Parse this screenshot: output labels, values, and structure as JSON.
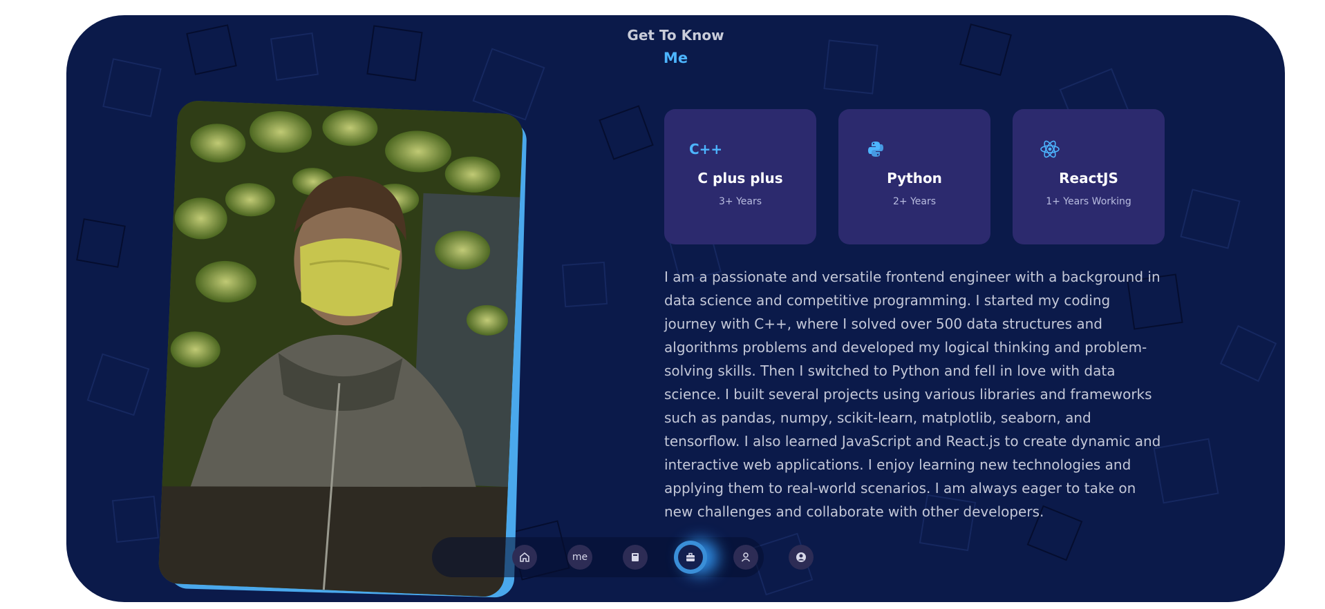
{
  "heading": {
    "subtitle": "Get To Know",
    "title": "Me"
  },
  "skills": [
    {
      "icon": "cplusplus-icon",
      "icon_text": "C++",
      "name": "C plus plus",
      "experience": "3+ Years"
    },
    {
      "icon": "python-icon",
      "name": "Python",
      "experience": "2+ Years"
    },
    {
      "icon": "react-icon",
      "name": "ReactJS",
      "experience": "1+ Years Working"
    }
  ],
  "about_text": "I am a passionate and versatile frontend engineer with a background in data science and competitive programming. I started my coding journey with C++, where I solved over 500 data structures and algorithms problems and developed my logical thinking and problem-solving skills. Then I switched to Python and fell in love with data science. I built several projects using various libraries and frameworks such as pandas, numpy, scikit-learn, matplotlib, seaborn, and tensorflow. I also learned JavaScript and React.js to create dynamic and interactive web applications. I enjoy learning new technologies and applying them to real-world scenarios. I am always eager to take on new challenges and collaborate with other developers.",
  "nav": {
    "items": [
      {
        "icon": "home-icon"
      },
      {
        "label": "me"
      },
      {
        "icon": "book-icon"
      },
      {
        "icon": "briefcase-icon",
        "active": true
      },
      {
        "icon": "user-icon"
      },
      {
        "icon": "user-circle-icon"
      }
    ]
  },
  "colors": {
    "background": "#0b1a4a",
    "accent": "#4db5ff",
    "card": "#2c2a6e",
    "photo_frame": "#4aa8ec"
  }
}
